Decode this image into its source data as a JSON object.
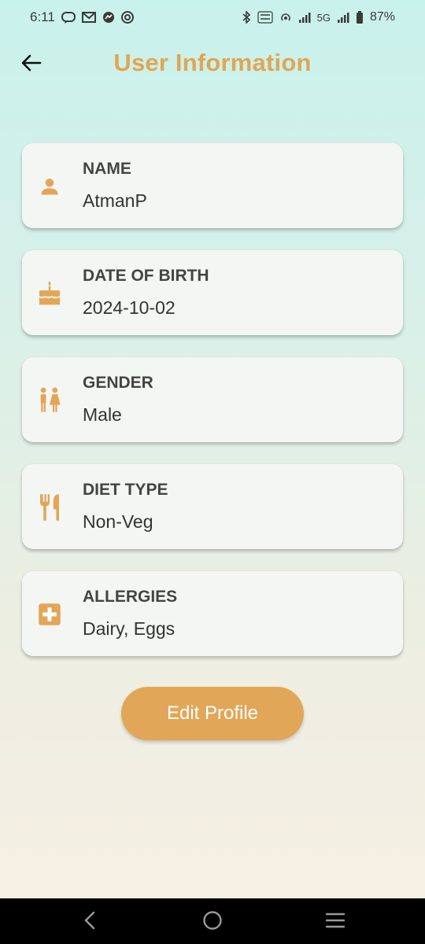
{
  "status_bar": {
    "time": "6:11",
    "network_label": "5G",
    "battery": "87%",
    "notification_icons": [
      "chat-bubble-icon",
      "gmail-icon",
      "messenger-icon",
      "app-icon"
    ],
    "system_icons": [
      "bluetooth-icon",
      "volte-icon",
      "hotspot-icon",
      "signal-icon",
      "signal-icon-2",
      "battery-icon"
    ]
  },
  "header": {
    "title": "User Information",
    "back_icon": "arrow-left-icon"
  },
  "cards": [
    {
      "label": "NAME",
      "value": "AtmanP",
      "icon": "person-icon"
    },
    {
      "label": "DATE OF BIRTH",
      "value": "2024-10-02",
      "icon": "cake-icon"
    },
    {
      "label": "GENDER",
      "value": "Male",
      "icon": "wc-icon"
    },
    {
      "label": "DIET TYPE",
      "value": "Non-Veg",
      "icon": "restaurant-icon"
    },
    {
      "label": "ALLERGIES",
      "value": "Dairy, Eggs",
      "icon": "medical-cross-icon"
    }
  ],
  "edit_button": {
    "label": "Edit Profile"
  },
  "colors": {
    "accent": "#e2a658",
    "title": "#e0a654",
    "card_bg": "#f4f6f4",
    "nav_bg": "#000000"
  },
  "nav": {
    "icons": [
      "nav-back-icon",
      "nav-home-icon",
      "nav-recents-icon"
    ]
  }
}
